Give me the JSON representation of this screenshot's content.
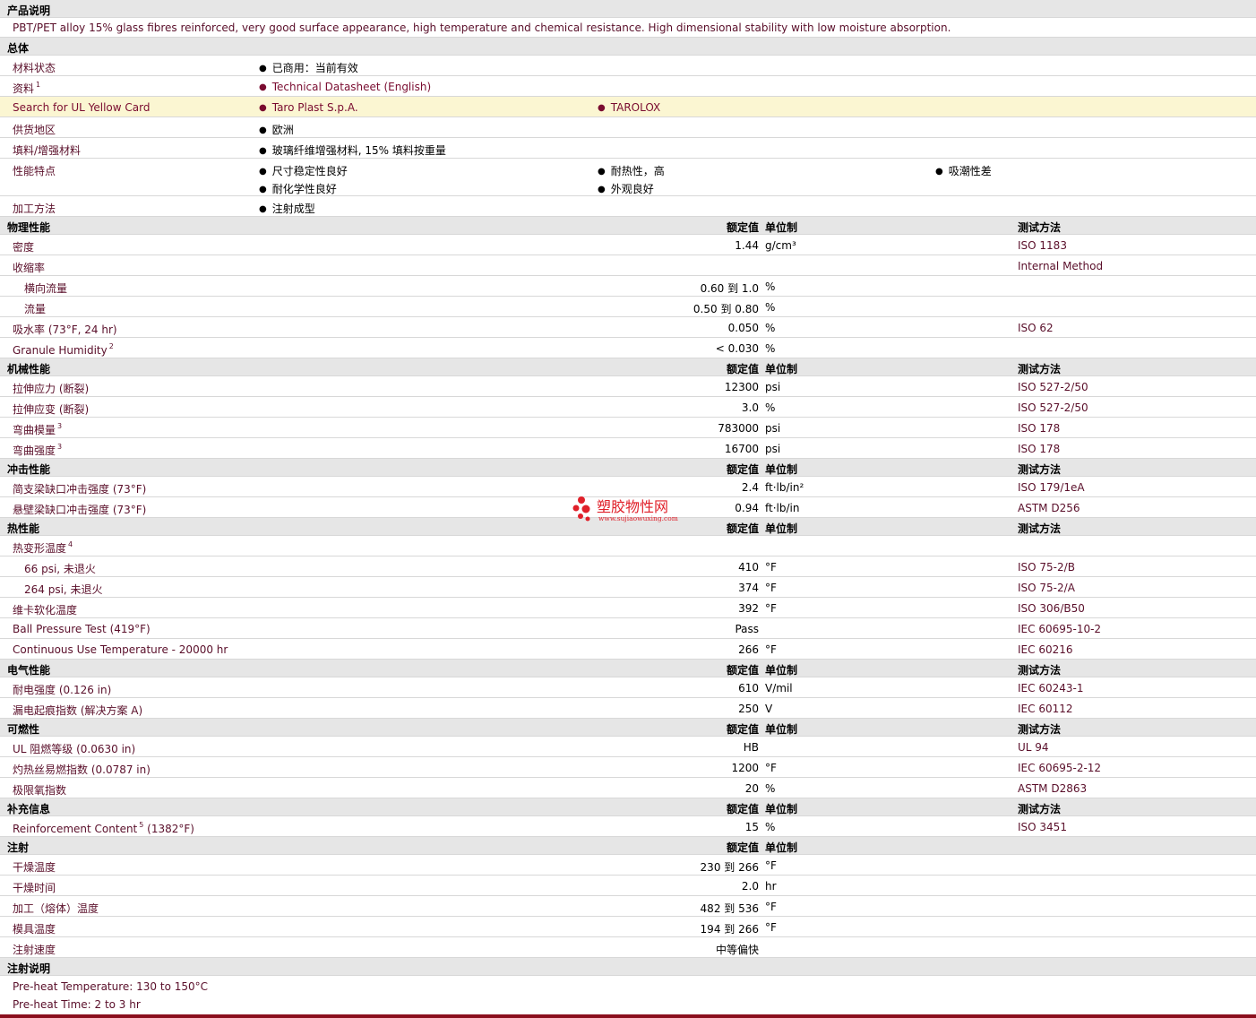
{
  "sections": {
    "product": "产品说明",
    "general": "总体",
    "physical": "物理性能",
    "mechanical": "机械性能",
    "impact": "冲击性能",
    "thermal": "热性能",
    "electrical": "电气性能",
    "flammability": "可燃性",
    "supplement": "补充信息",
    "injection": "注射",
    "injection_notes": "注射说明"
  },
  "columns": {
    "value": "额定值",
    "unit": "单位制",
    "method": "测试方法"
  },
  "description": "PBT/PET alloy 15% glass fibres reinforced, very good surface appearance, high temperature and chemical resistance. High dimensional stability with low moisture absorption.",
  "general": {
    "status_label": "材料状态",
    "status_value": "已商用：当前有效",
    "docs_label": "资料",
    "docs_sup": "1",
    "docs_value": "Technical Datasheet (English)",
    "ul_label": "Search for UL Yellow Card",
    "ul_v1": "Taro Plast S.p.A.",
    "ul_v2": "TAROLOX",
    "region_label": "供货地区",
    "region_value": "欧洲",
    "filler_label": "填料/增强材料",
    "filler_value": "玻璃纤维增强材料, 15% 填料按重量",
    "features_label": "性能特点",
    "features": [
      "尺寸稳定性良好",
      "耐热性，高",
      "吸潮性差",
      "耐化学性良好",
      "外观良好"
    ],
    "process_label": "加工方法",
    "process_value": "注射成型"
  },
  "physical": [
    {
      "label": "密度",
      "value": "1.44",
      "unit": "g/cm³",
      "method": "ISO 1183"
    },
    {
      "label": "收缩率",
      "value": "",
      "unit": "",
      "method": "Internal Method"
    },
    {
      "label": "横向流量",
      "value": "0.60 到  1.0",
      "unit": "%",
      "method": ""
    },
    {
      "label": "流量",
      "value": "0.50 到  0.80",
      "unit": "%",
      "method": ""
    },
    {
      "label": "吸水率  (73°F, 24 hr)",
      "value": "0.050",
      "unit": "%",
      "method": "ISO 62"
    },
    {
      "label": "Granule Humidity",
      "sup": "2",
      "value": "< 0.030",
      "unit": "%",
      "method": ""
    }
  ],
  "mechanical": [
    {
      "label": "拉伸应力  (断裂)",
      "value": "12300",
      "unit": "psi",
      "method": "ISO 527-2/50"
    },
    {
      "label": "拉伸应变  (断裂)",
      "value": "3.0",
      "unit": "%",
      "method": "ISO 527-2/50"
    },
    {
      "label": "弯曲模量",
      "sup": "3",
      "value": "783000",
      "unit": "psi",
      "method": "ISO 178"
    },
    {
      "label": "弯曲强度",
      "sup": "3",
      "value": "16700",
      "unit": "psi",
      "method": "ISO 178"
    }
  ],
  "impact": [
    {
      "label": "简支梁缺口冲击强度  (73°F)",
      "value": "2.4",
      "unit": "ft·lb/in²",
      "method": "ISO 179/1eA"
    },
    {
      "label": "悬壁梁缺口冲击强度  (73°F)",
      "value": "0.94",
      "unit": "ft·lb/in",
      "method": "ASTM D256"
    }
  ],
  "thermal": [
    {
      "label": "热变形温度",
      "sup": "4",
      "value": "",
      "unit": "",
      "method": ""
    },
    {
      "label": "66 psi, 未退火",
      "value": "410",
      "unit": "°F",
      "method": "ISO 75-2/B"
    },
    {
      "label": "264 psi, 未退火",
      "value": "374",
      "unit": "°F",
      "method": "ISO 75-2/A"
    },
    {
      "label": "维卡软化温度",
      "value": "392",
      "unit": "°F",
      "method": "ISO 306/B50"
    },
    {
      "label": "Ball Pressure Test (419°F)",
      "value": "Pass",
      "unit": "",
      "method": "IEC 60695-10-2"
    },
    {
      "label": "Continuous Use Temperature - 20000 hr",
      "value": "266",
      "unit": "°F",
      "method": "IEC 60216"
    }
  ],
  "electrical": [
    {
      "label": "耐电强度  (0.126 in)",
      "value": "610",
      "unit": "V/mil",
      "method": "IEC 60243-1"
    },
    {
      "label": "漏电起痕指数  (解决方案  A)",
      "value": "250",
      "unit": "V",
      "method": "IEC 60112"
    }
  ],
  "flammability": [
    {
      "label": "UL 阻燃等级  (0.0630 in)",
      "value": "HB",
      "unit": "",
      "method": "UL 94"
    },
    {
      "label": "灼热丝易燃指数  (0.0787 in)",
      "value": "1200",
      "unit": "°F",
      "method": "IEC 60695-2-12"
    },
    {
      "label": "极限氧指数",
      "value": "20",
      "unit": "%",
      "method": "ASTM D2863"
    }
  ],
  "supplement": [
    {
      "label": "Reinforcement Content",
      "sup": "5",
      "label2": " (1382°F)",
      "value": "15",
      "unit": "%",
      "method": "ISO 3451"
    }
  ],
  "injection": [
    {
      "label": "干燥温度",
      "value": "230 到  266",
      "unit": "°F"
    },
    {
      "label": "干燥时间",
      "value": "2.0",
      "unit": "hr"
    },
    {
      "label": "加工（熔体）温度",
      "value": "482 到  536",
      "unit": "°F"
    },
    {
      "label": "模具温度",
      "value": "194 到  266",
      "unit": "°F"
    },
    {
      "label": "注射速度",
      "value": "中等偏快",
      "unit": ""
    }
  ],
  "injection_notes": [
    "Pre-heat Temperature: 130 to 150°C",
    "Pre-heat Time: 2 to 3 hr"
  ],
  "watermark": {
    "cn": "塑胶物性网",
    "url": "www.sujiaowuxing.com",
    "color": "#e0202a"
  }
}
